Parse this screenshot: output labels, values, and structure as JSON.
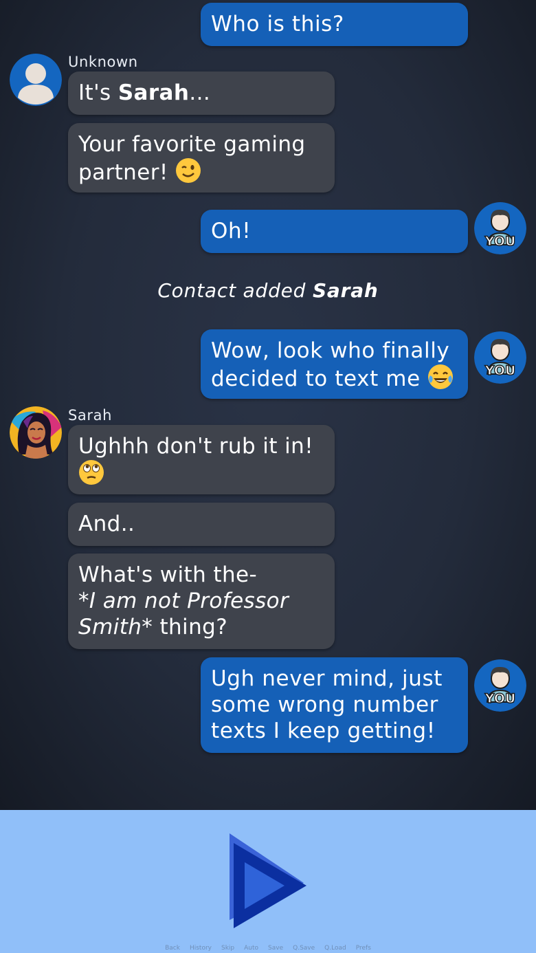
{
  "messages": {
    "m1": {
      "text": "Who is this?"
    },
    "m2": {
      "sender": "Unknown",
      "prefix": "It's ",
      "bold": "Sarah",
      "suffix": "..."
    },
    "m3": {
      "text": "Your favorite gaming partner!",
      "emoji": "winking-face"
    },
    "m4": {
      "text": "Oh!"
    },
    "m5": {
      "prefix": "Contact added ",
      "bold": "Sarah"
    },
    "m6": {
      "line1": "Wow, look who finally",
      "line2": "decided to text me",
      "emoji": "face-with-tears-of-joy"
    },
    "m7": {
      "sender": "Sarah",
      "text": "Ughhh don't rub it in!",
      "emoji": "face-with-rolling-eyes"
    },
    "m8": {
      "text": "And.."
    },
    "m9": {
      "line1": "What's with the-",
      "italic": "*I am not Professor Smith*",
      "suffix": " thing?"
    },
    "m10": {
      "line1": "Ugh never mind, just",
      "line2": "some wrong number",
      "line3": "texts I keep getting!"
    }
  },
  "avatars": {
    "user_badge": "YOU",
    "unknown_icon": "person-silhouette-icon",
    "sarah_icon": "sarah-portrait"
  },
  "colors": {
    "outgoing_bubble": "#1560b7",
    "incoming_bubble": "#3f434c",
    "bottom_bar": "#90bff9",
    "play_button": "#1e4fd1"
  },
  "quick_menu": {
    "back": "Back",
    "history": "History",
    "skip": "Skip",
    "auto": "Auto",
    "save": "Save",
    "qsave": "Q.Save",
    "qload": "Q.Load",
    "prefs": "Prefs"
  }
}
